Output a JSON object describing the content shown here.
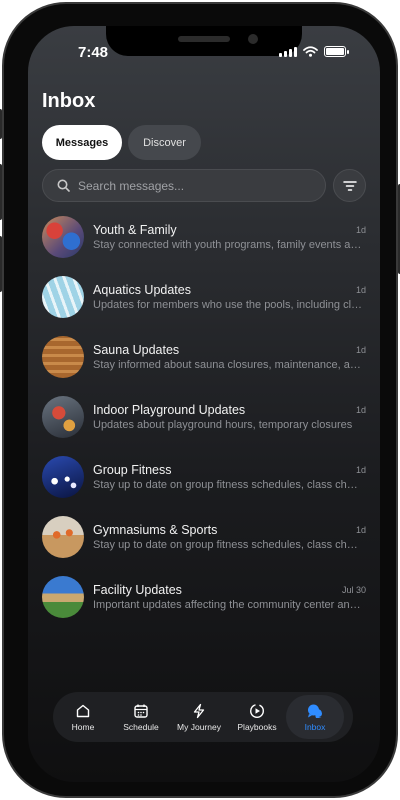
{
  "status_bar": {
    "time": "7:48"
  },
  "header": {
    "title": "Inbox"
  },
  "segments": {
    "messages": "Messages",
    "discover": "Discover"
  },
  "search": {
    "placeholder": "Search messages..."
  },
  "messages": [
    {
      "title": "Youth & Family",
      "preview": "Stay connected with youth programs, family events and more",
      "time": "1d"
    },
    {
      "title": "Aquatics Updates",
      "preview": "Updates for members who use the pools, including closures",
      "time": "1d"
    },
    {
      "title": "Sauna Updates",
      "preview": "Stay informed about sauna closures, maintenance, and more",
      "time": "1d"
    },
    {
      "title": "Indoor Playground Updates",
      "preview": "Updates about playground hours, temporary closures",
      "time": "1d"
    },
    {
      "title": "Group Fitness",
      "preview": "Stay up to date on group fitness schedules, class changes",
      "time": "1d"
    },
    {
      "title": "Gymnasiums & Sports",
      "preview": "Stay up to date on group fitness schedules, class changes",
      "time": "1d"
    },
    {
      "title": "Facility Updates",
      "preview": "Important updates affecting the community center and more",
      "time": "Jul 30"
    }
  ],
  "tabs": [
    {
      "label": "Home",
      "icon": "home-icon"
    },
    {
      "label": "Schedule",
      "icon": "calendar-icon"
    },
    {
      "label": "My Journey",
      "icon": "lightning-icon"
    },
    {
      "label": "Playbooks",
      "icon": "play-circle-icon"
    },
    {
      "label": "Inbox",
      "icon": "chat-bubble-icon"
    }
  ],
  "colors": {
    "accent": "#2f8cff",
    "background": "#1b1c1f",
    "active_segment": "#ffffff"
  }
}
